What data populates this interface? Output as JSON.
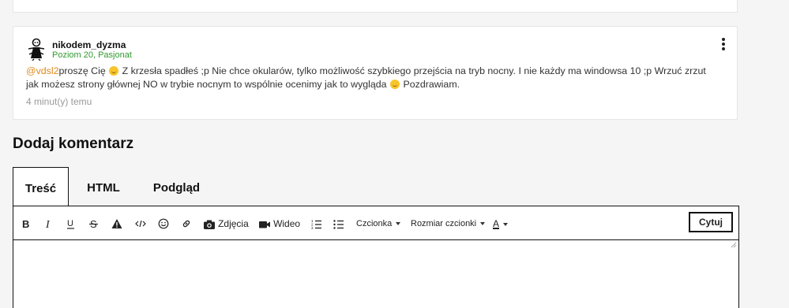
{
  "comment": {
    "author": "nikodem_dyzma",
    "rank": "Poziom 20, Pasjonat",
    "mention": "@vdsl2",
    "text_1": "proszę Cię",
    "text_2": " Z krzesła spadłeś ;p Nie chce okularów, tylko możliwość szybkiego przejścia na tryb nocny. I nie każdy ma windowsa 10 ;p Wrzuć zrzut jak możesz strony głównej NO w trybie nocnym to wspólnie ocenimy jak to wygląda",
    "text_3": " Pozdrawiam.",
    "timestamp": "4 minut(y) temu",
    "mention_color": "#e08a1e",
    "rank_color": "#2e9a2e"
  },
  "editor": {
    "title": "Dodaj komentarz",
    "tabs": [
      {
        "label": "Treść",
        "active": true
      },
      {
        "label": "HTML",
        "active": false
      },
      {
        "label": "Podgląd",
        "active": false
      }
    ],
    "toolbar": {
      "bold_icon": "bold-icon",
      "italic_icon": "italic-icon",
      "underline_icon": "underline-icon",
      "strike_icon": "strikethrough-icon",
      "warning_icon": "warning-icon",
      "code_icon": "code-icon",
      "emoji_icon": "emoji-icon",
      "link_icon": "link-icon",
      "photos_label": "Zdjęcia",
      "video_label": "Wideo",
      "font_label": "Czcionka",
      "font_size_label": "Rozmiar czcionki",
      "font_color_label": "A",
      "quote_label": "Cytuj"
    }
  }
}
